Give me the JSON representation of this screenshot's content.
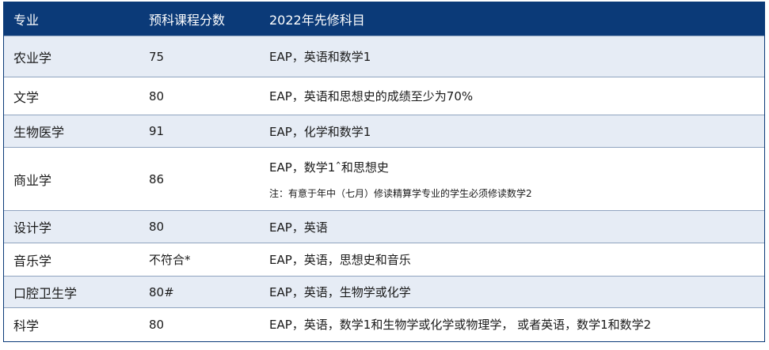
{
  "headers": [
    "专业",
    "预科课程分数",
    "2022年先修科目"
  ],
  "rows": [
    {
      "major": "农业学",
      "score": "75",
      "prereq": "EAP，英语和数学1"
    },
    {
      "major": "文学",
      "score": "80",
      "prereq": "EAP，英语和思想史的成绩至少为70%"
    },
    {
      "major": "生物医学",
      "score": "91",
      "prereq": "EAP，化学和数学1"
    },
    {
      "major": "商业学",
      "score": "86",
      "prereq": "EAP，数学1ˆ和思想史",
      "note": "注：有意于年中（七月）修读精算学专业的学生必须修读数学2"
    },
    {
      "major": "设计学",
      "score": "80",
      "prereq": "EAP，英语"
    },
    {
      "major": "音乐学",
      "score": "不符合*",
      "prereq": "EAP，英语，思想史和音乐"
    },
    {
      "major": "口腔卫生学",
      "score": "80#",
      "prereq": "EAP，英语，生物学或化学"
    },
    {
      "major": "科学",
      "score": "80",
      "prereq": "EAP，英语，数学1和生物学或化学或物理学，   或者英语，数学1和数学2"
    }
  ]
}
